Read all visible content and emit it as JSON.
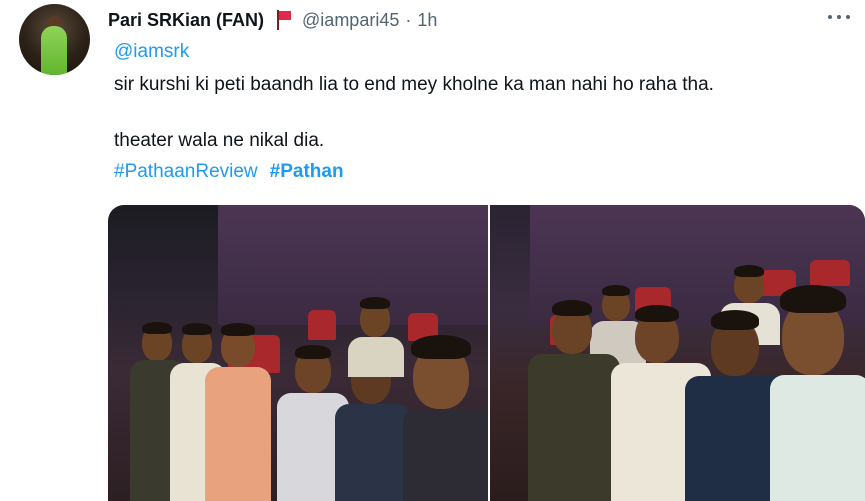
{
  "tweet": {
    "display_name": "Pari SRKian (FAN)",
    "flag_icon": "red-flag-icon",
    "handle": "@iampari45",
    "separator": "·",
    "time": "1h",
    "more_icon": "more-options-icon",
    "mention": "@iamsrk",
    "text_line1": "sir kurshi ki peti baandh lia to end mey kholne ka man nahi ho raha tha.",
    "text_line2": "theater wala ne nikal dia.",
    "hashtags": [
      "#PathaanReview",
      "#Pathan"
    ],
    "media": {
      "photo_count": 2,
      "photos": [
        "selfie-in-theater-left",
        "selfie-in-theater-right"
      ]
    }
  },
  "colors": {
    "link": "#1d9bf0",
    "secondary_text": "#536471",
    "primary_text": "#0f1419",
    "flag": "#e0284a"
  }
}
